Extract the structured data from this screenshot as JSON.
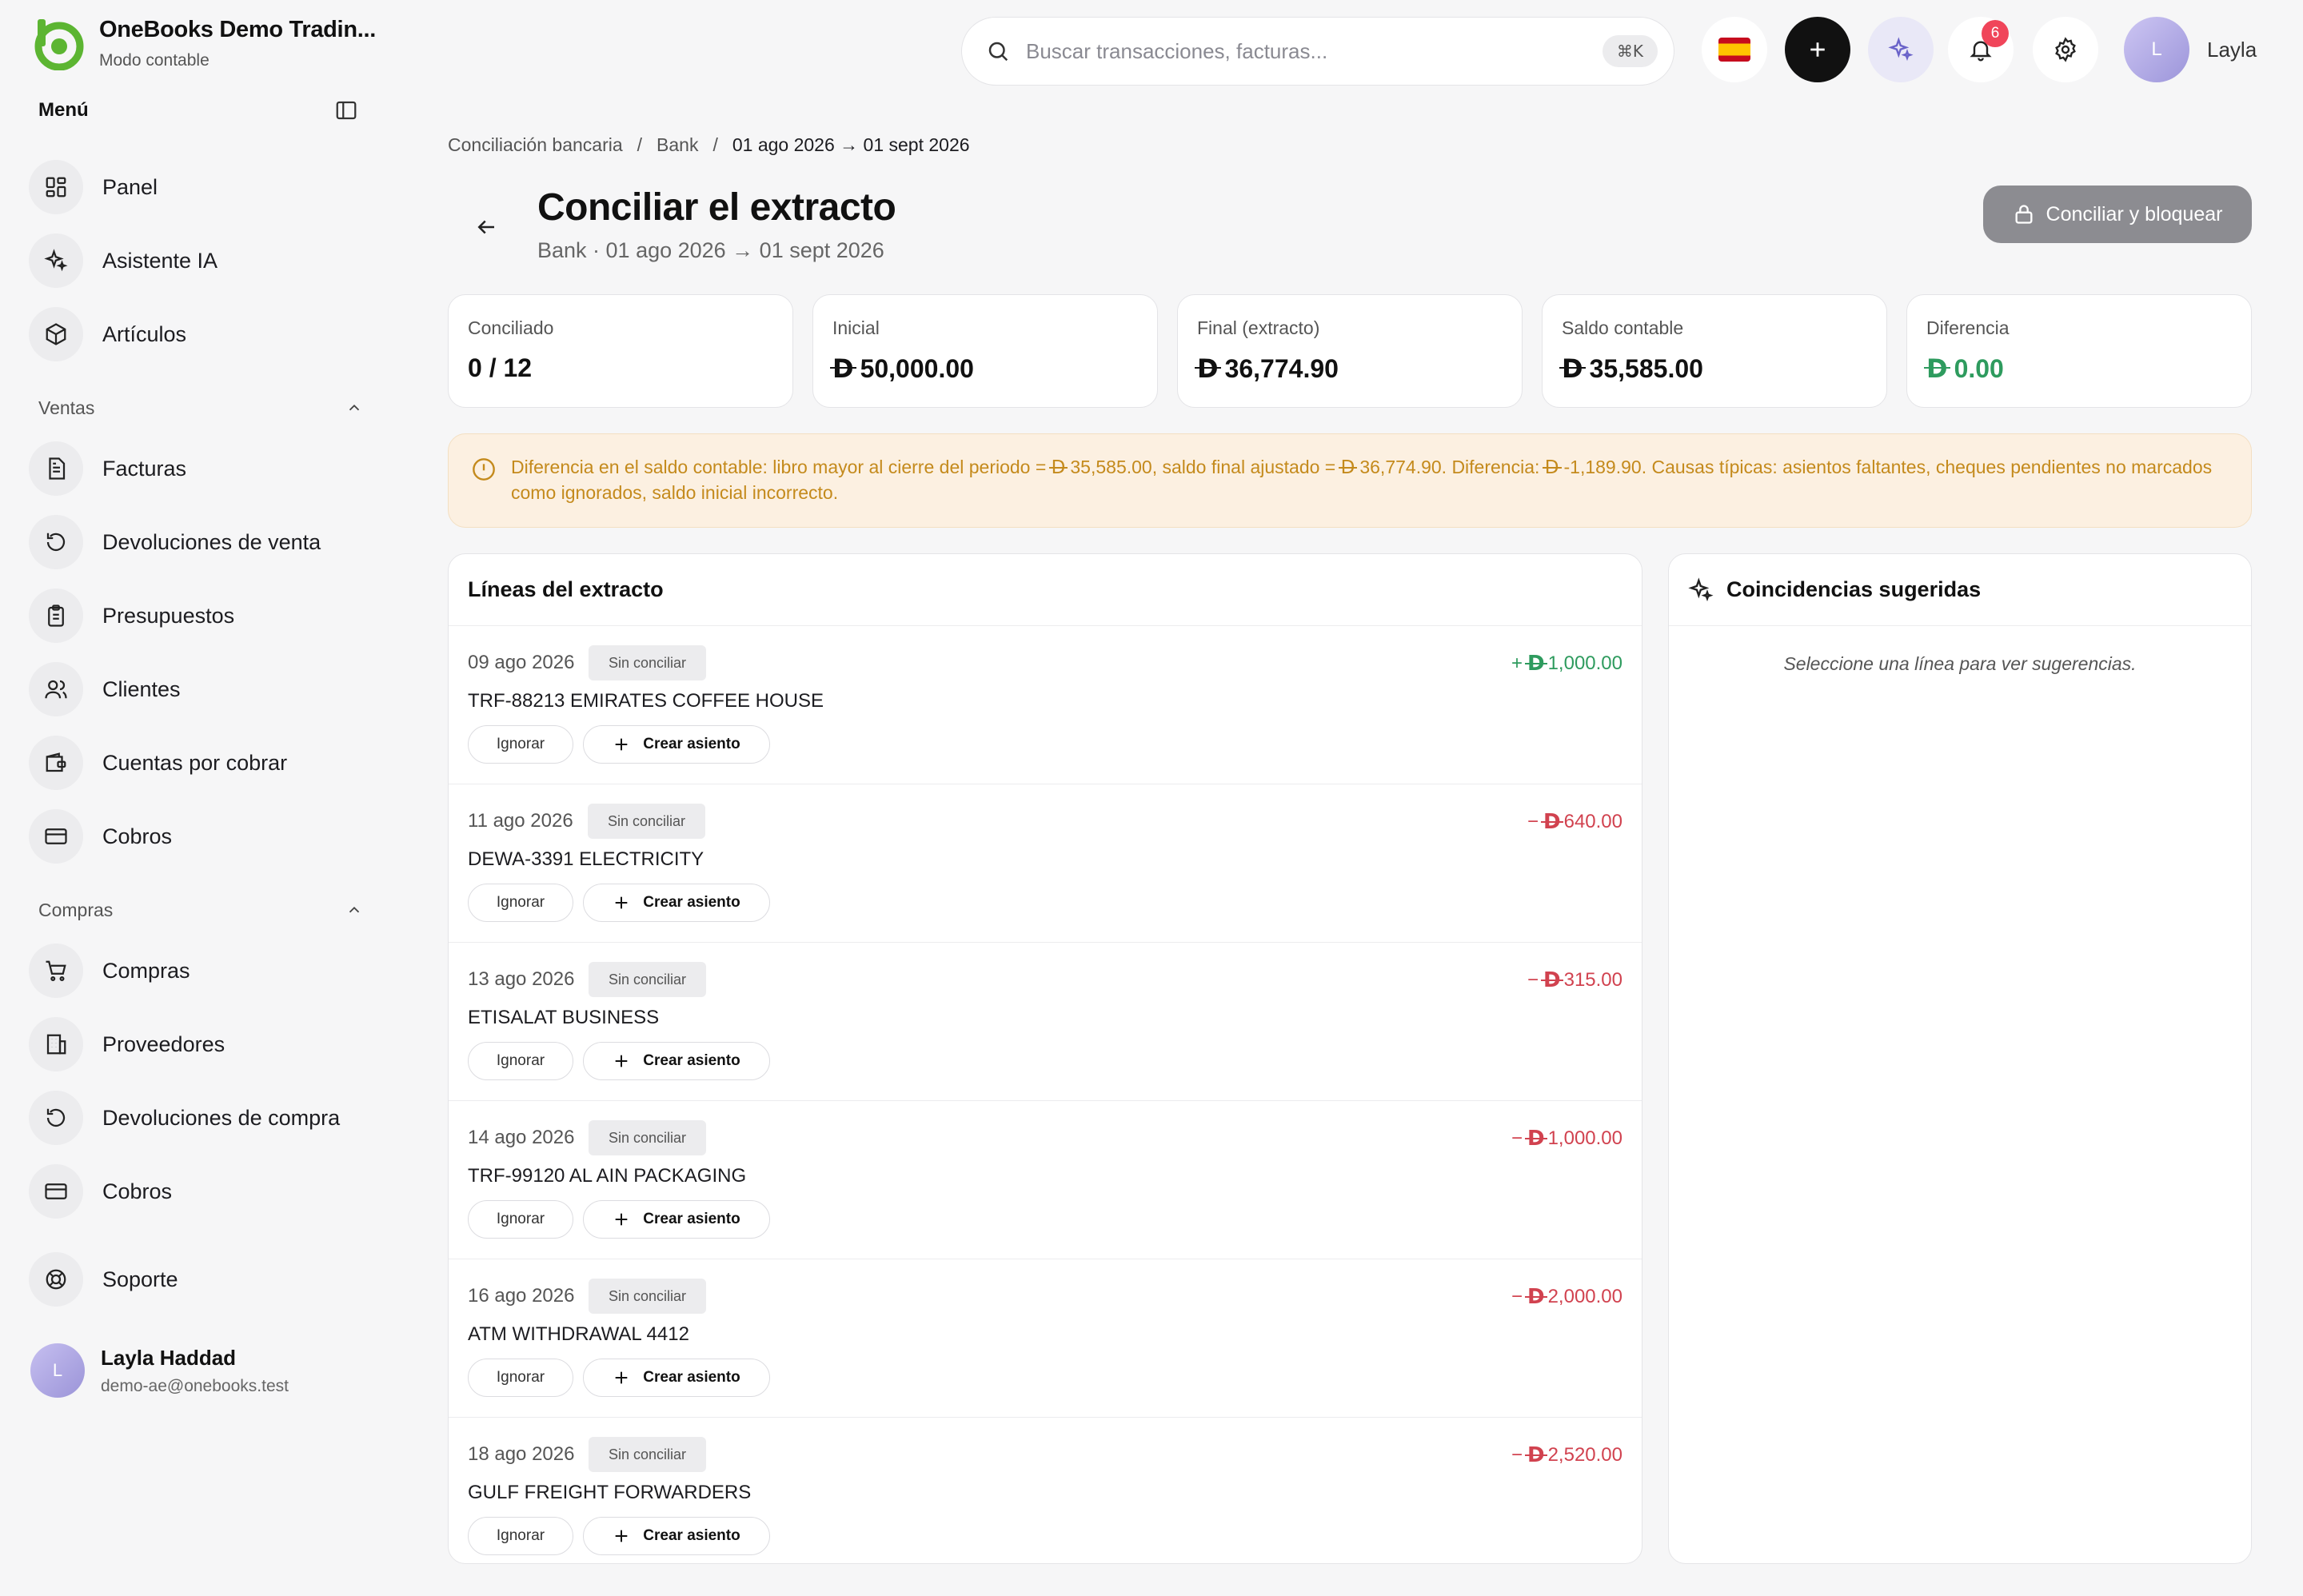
{
  "brand": {
    "name": "OneBooks Demo Tradin...",
    "subtitle": "Modo contable"
  },
  "sidebar": {
    "menu_label": "Menú",
    "items_top": [
      {
        "label": "Panel",
        "icon": "dashboard-icon"
      },
      {
        "label": "Asistente IA",
        "icon": "sparkles-icon"
      },
      {
        "label": "Artículos",
        "icon": "box-icon"
      }
    ],
    "sections": [
      {
        "label": "Ventas",
        "items": [
          {
            "label": "Facturas",
            "icon": "document-icon"
          },
          {
            "label": "Devoluciones de venta",
            "icon": "undo-icon"
          },
          {
            "label": "Presupuestos",
            "icon": "clipboard-icon"
          },
          {
            "label": "Clientes",
            "icon": "users-icon"
          },
          {
            "label": "Cuentas por cobrar",
            "icon": "wallet-icon"
          },
          {
            "label": "Cobros",
            "icon": "card-icon"
          }
        ]
      },
      {
        "label": "Compras",
        "items": [
          {
            "label": "Compras",
            "icon": "cart-icon"
          },
          {
            "label": "Proveedores",
            "icon": "building-icon"
          },
          {
            "label": "Devoluciones de compra",
            "icon": "undo-icon"
          },
          {
            "label": "Cobros",
            "icon": "card-icon"
          }
        ]
      }
    ],
    "support": {
      "label": "Soporte",
      "icon": "lifebuoy-icon"
    },
    "user": {
      "initial": "L",
      "name": "Layla Haddad",
      "email": "demo-ae@onebooks.test"
    }
  },
  "topbar": {
    "search_placeholder": "Buscar transacciones, facturas...",
    "search_shortcut": "⌘K",
    "notifications_count": "6",
    "user_initial": "L",
    "user_name": "Layla"
  },
  "breadcrumb": [
    "Conciliación bancaria",
    "Bank",
    "01 ago 2026 → 01 sept 2026"
  ],
  "page": {
    "title": "Conciliar el extracto",
    "subtitle": "Bank · 01 ago 2026 → 01 sept 2026",
    "lock_button": "Conciliar y bloquear"
  },
  "currency_symbol": "D",
  "stats": [
    {
      "label": "Conciliado",
      "value": "0 / 12",
      "currency": false
    },
    {
      "label": "Inicial",
      "value": "50,000.00",
      "currency": true
    },
    {
      "label": "Final (extracto)",
      "value": "36,774.90",
      "currency": true
    },
    {
      "label": "Saldo contable",
      "value": "35,585.00",
      "currency": true
    },
    {
      "label": "Diferencia",
      "value": "0.00",
      "currency": true,
      "color": "#2e9b5e"
    }
  ],
  "alert": {
    "parts": [
      "Diferencia en el saldo contable: libro mayor al cierre del periodo = ",
      "35,585.00, saldo final ajustado = ",
      "36,774.90. Diferencia: ",
      "-1,189.90. Causas típicas: asientos faltantes, cheques pendientes no marcados como ignorados, saldo inicial incorrecto."
    ]
  },
  "statement": {
    "title": "Líneas del extracto",
    "ignore_label": "Ignorar",
    "create_label": "Crear asiento",
    "lines": [
      {
        "date": "09 ago 2026",
        "status": "Sin conciliar",
        "description": "TRF-88213 EMIRATES COFFEE HOUSE",
        "sign": "+",
        "amount": "1,000.00",
        "direction": "pos"
      },
      {
        "date": "11 ago 2026",
        "status": "Sin conciliar",
        "description": "DEWA-3391 ELECTRICITY",
        "sign": "−",
        "amount": "640.00",
        "direction": "neg"
      },
      {
        "date": "13 ago 2026",
        "status": "Sin conciliar",
        "description": "ETISALAT BUSINESS",
        "sign": "−",
        "amount": "315.00",
        "direction": "neg"
      },
      {
        "date": "14 ago 2026",
        "status": "Sin conciliar",
        "description": "TRF-99120 AL AIN PACKAGING",
        "sign": "−",
        "amount": "1,000.00",
        "direction": "neg"
      },
      {
        "date": "16 ago 2026",
        "status": "Sin conciliar",
        "description": "ATM WITHDRAWAL 4412",
        "sign": "−",
        "amount": "2,000.00",
        "direction": "neg"
      },
      {
        "date": "18 ago 2026",
        "status": "Sin conciliar",
        "description": "GULF FREIGHT FORWARDERS",
        "sign": "−",
        "amount": "2,520.00",
        "direction": "neg"
      }
    ]
  },
  "suggestions": {
    "title": "Coincidencias sugeridas",
    "empty": "Seleccione una línea para ver sugerencias."
  },
  "colors": {
    "accent_green": "#2e9b5e",
    "negative_red": "#d1424f",
    "warning": "#c48a1c",
    "brand_green": "#5cb532"
  }
}
